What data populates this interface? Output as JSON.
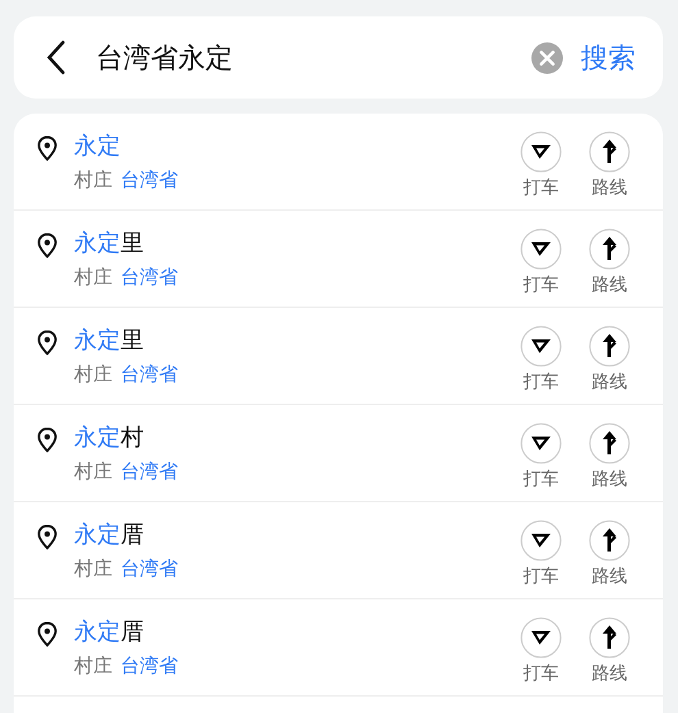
{
  "search": {
    "value": "台湾省永定",
    "action": "搜索"
  },
  "results": [
    {
      "match": "永定",
      "type": "村庄",
      "region": "台湾省",
      "actions": [
        "打车",
        "路线"
      ]
    },
    {
      "match": "永定",
      "rest": "里",
      "type": "村庄",
      "region": "台湾省",
      "actions": [
        "打车",
        "路线"
      ]
    },
    {
      "match": "永定",
      "rest": "里",
      "type": "村庄",
      "region": "台湾省",
      "actions": [
        "打车",
        "路线"
      ]
    },
    {
      "match": "永定",
      "rest": "村",
      "type": "村庄",
      "region": "台湾省",
      "actions": [
        "打车",
        "路线"
      ]
    },
    {
      "match": "永定",
      "rest": "厝",
      "type": "村庄",
      "region": "台湾省",
      "actions": [
        "打车",
        "路线"
      ]
    },
    {
      "match": "永定",
      "rest": "厝",
      "type": "村庄",
      "region": "台湾省",
      "actions": [
        "打车",
        "路线"
      ]
    }
  ]
}
